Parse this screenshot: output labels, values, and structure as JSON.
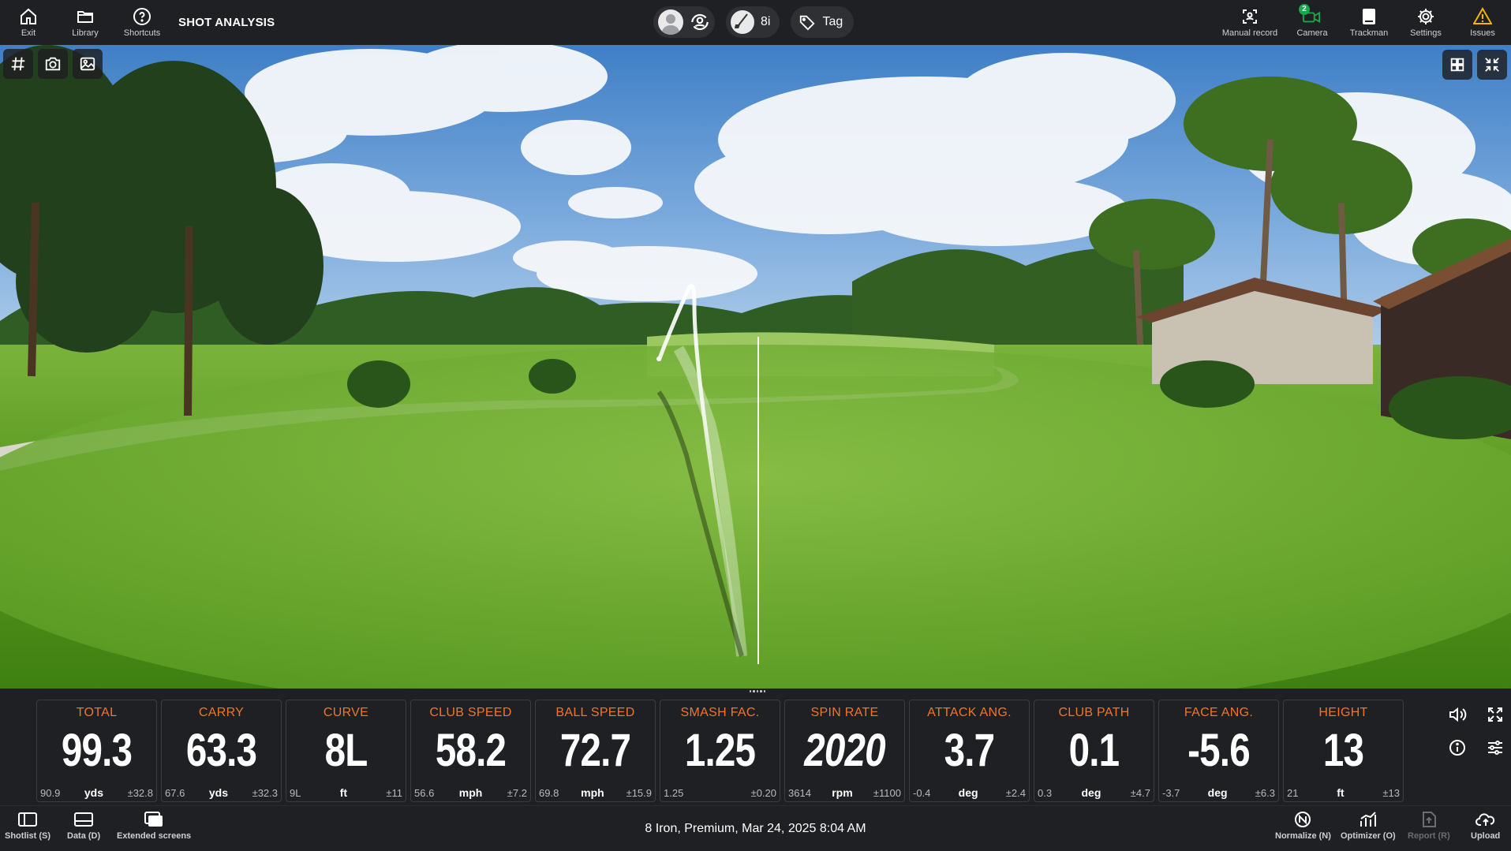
{
  "topbar": {
    "exit_label": "Exit",
    "library_label": "Library",
    "shortcuts_label": "Shortcuts",
    "title": "SHOT ANALYSIS",
    "club": "8i",
    "tag_label": "Tag",
    "manual_record_label": "Manual record",
    "camera_label": "Camera",
    "camera_count": "2",
    "trackman_label": "Trackman",
    "settings_label": "Settings",
    "issues_label": "Issues"
  },
  "metrics": [
    {
      "label": "TOTAL",
      "value": "99.3",
      "min": "90.9",
      "unit": "yds",
      "dev": "±32.8"
    },
    {
      "label": "CARRY",
      "value": "63.3",
      "min": "67.6",
      "unit": "yds",
      "dev": "±32.3"
    },
    {
      "label": "CURVE",
      "value": "8L",
      "min": "9L",
      "unit": "ft",
      "dev": "±11"
    },
    {
      "label": "CLUB SPEED",
      "value": "58.2",
      "min": "56.6",
      "unit": "mph",
      "dev": "±7.2"
    },
    {
      "label": "BALL SPEED",
      "value": "72.7",
      "min": "69.8",
      "unit": "mph",
      "dev": "±15.9"
    },
    {
      "label": "SMASH FAC.",
      "value": "1.25",
      "min": "1.25",
      "unit": "",
      "dev": "±0.20"
    },
    {
      "label": "SPIN RATE",
      "value": "2020",
      "min": "3614",
      "unit": "rpm",
      "dev": "±1100"
    },
    {
      "label": "ATTACK ANG.",
      "value": "3.7",
      "min": "-0.4",
      "unit": "deg",
      "dev": "±2.4"
    },
    {
      "label": "CLUB PATH",
      "value": "0.1",
      "min": "0.3",
      "unit": "deg",
      "dev": "±4.7"
    },
    {
      "label": "FACE ANG.",
      "value": "-5.6",
      "min": "-3.7",
      "unit": "deg",
      "dev": "±6.3"
    },
    {
      "label": "HEIGHT",
      "value": "13",
      "min": "21",
      "unit": "ft",
      "dev": "±13"
    }
  ],
  "bottombar": {
    "shotlist_label": "Shotlist (S)",
    "data_label": "Data (D)",
    "extended_label": "Extended screens",
    "status": "8 Iron, Premium, Mar 24, 2025 8:04 AM",
    "normalize_label": "Normalize (N)",
    "optimizer_label": "Optimizer (O)",
    "report_label": "Report (R)",
    "upload_label": "Upload"
  },
  "colors": {
    "accent": "#f0752d",
    "bar": "#1f2023",
    "camera_badge": "#1aa64a",
    "issues": "#f5b400"
  }
}
